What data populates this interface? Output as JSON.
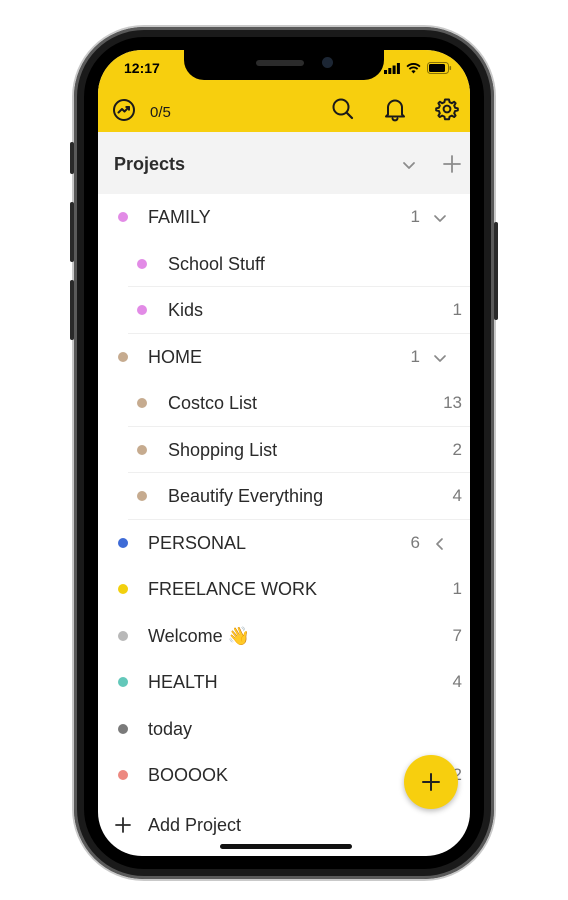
{
  "status_bar": {
    "time": "12:17"
  },
  "toolbar": {
    "karma_value": "0/5",
    "icons": [
      "karma-trend-icon",
      "search-icon",
      "bell-icon",
      "gear-icon"
    ]
  },
  "projects_header": {
    "title": "Projects"
  },
  "projects": [
    {
      "label": "FAMILY",
      "count": "1",
      "level": 0,
      "color": "#e28be6",
      "chevron": "down"
    },
    {
      "label": "School Stuff",
      "count": "",
      "level": 1,
      "color": "#e28be6"
    },
    {
      "label": "Kids",
      "count": "1",
      "level": 1,
      "color": "#e28be6"
    },
    {
      "label": "HOME",
      "count": "1",
      "level": 0,
      "color": "#c6ab8f",
      "chevron": "down"
    },
    {
      "label": "Costco List",
      "count": "13",
      "level": 1,
      "color": "#c6ab8f"
    },
    {
      "label": "Shopping List",
      "count": "2",
      "level": 1,
      "color": "#c6ab8f"
    },
    {
      "label": "Beautify Everything",
      "count": "4",
      "level": 1,
      "color": "#c6ab8f"
    },
    {
      "label": "PERSONAL",
      "count": "6",
      "level": 0,
      "color": "#3e6bd6",
      "chevron": "left"
    },
    {
      "label": "FREELANCE WORK",
      "count": "1",
      "level": 0,
      "color": "#f2d00e"
    },
    {
      "label": "Welcome 👋",
      "count": "7",
      "level": 0,
      "color": "#b8b8b8"
    },
    {
      "label": "HEALTH",
      "count": "4",
      "level": 0,
      "color": "#63c8ba"
    },
    {
      "label": "today",
      "count": "",
      "level": 0,
      "color": "#7a7a7a"
    },
    {
      "label": "BOOOOK",
      "count": "2",
      "level": 0,
      "color": "#ed8880"
    }
  ],
  "add_project": {
    "label": "Add Project"
  },
  "fab": {
    "icon": "plus-icon"
  },
  "colors": {
    "accent": "#f7cf0e",
    "header_bg": "#f3f3f3"
  }
}
